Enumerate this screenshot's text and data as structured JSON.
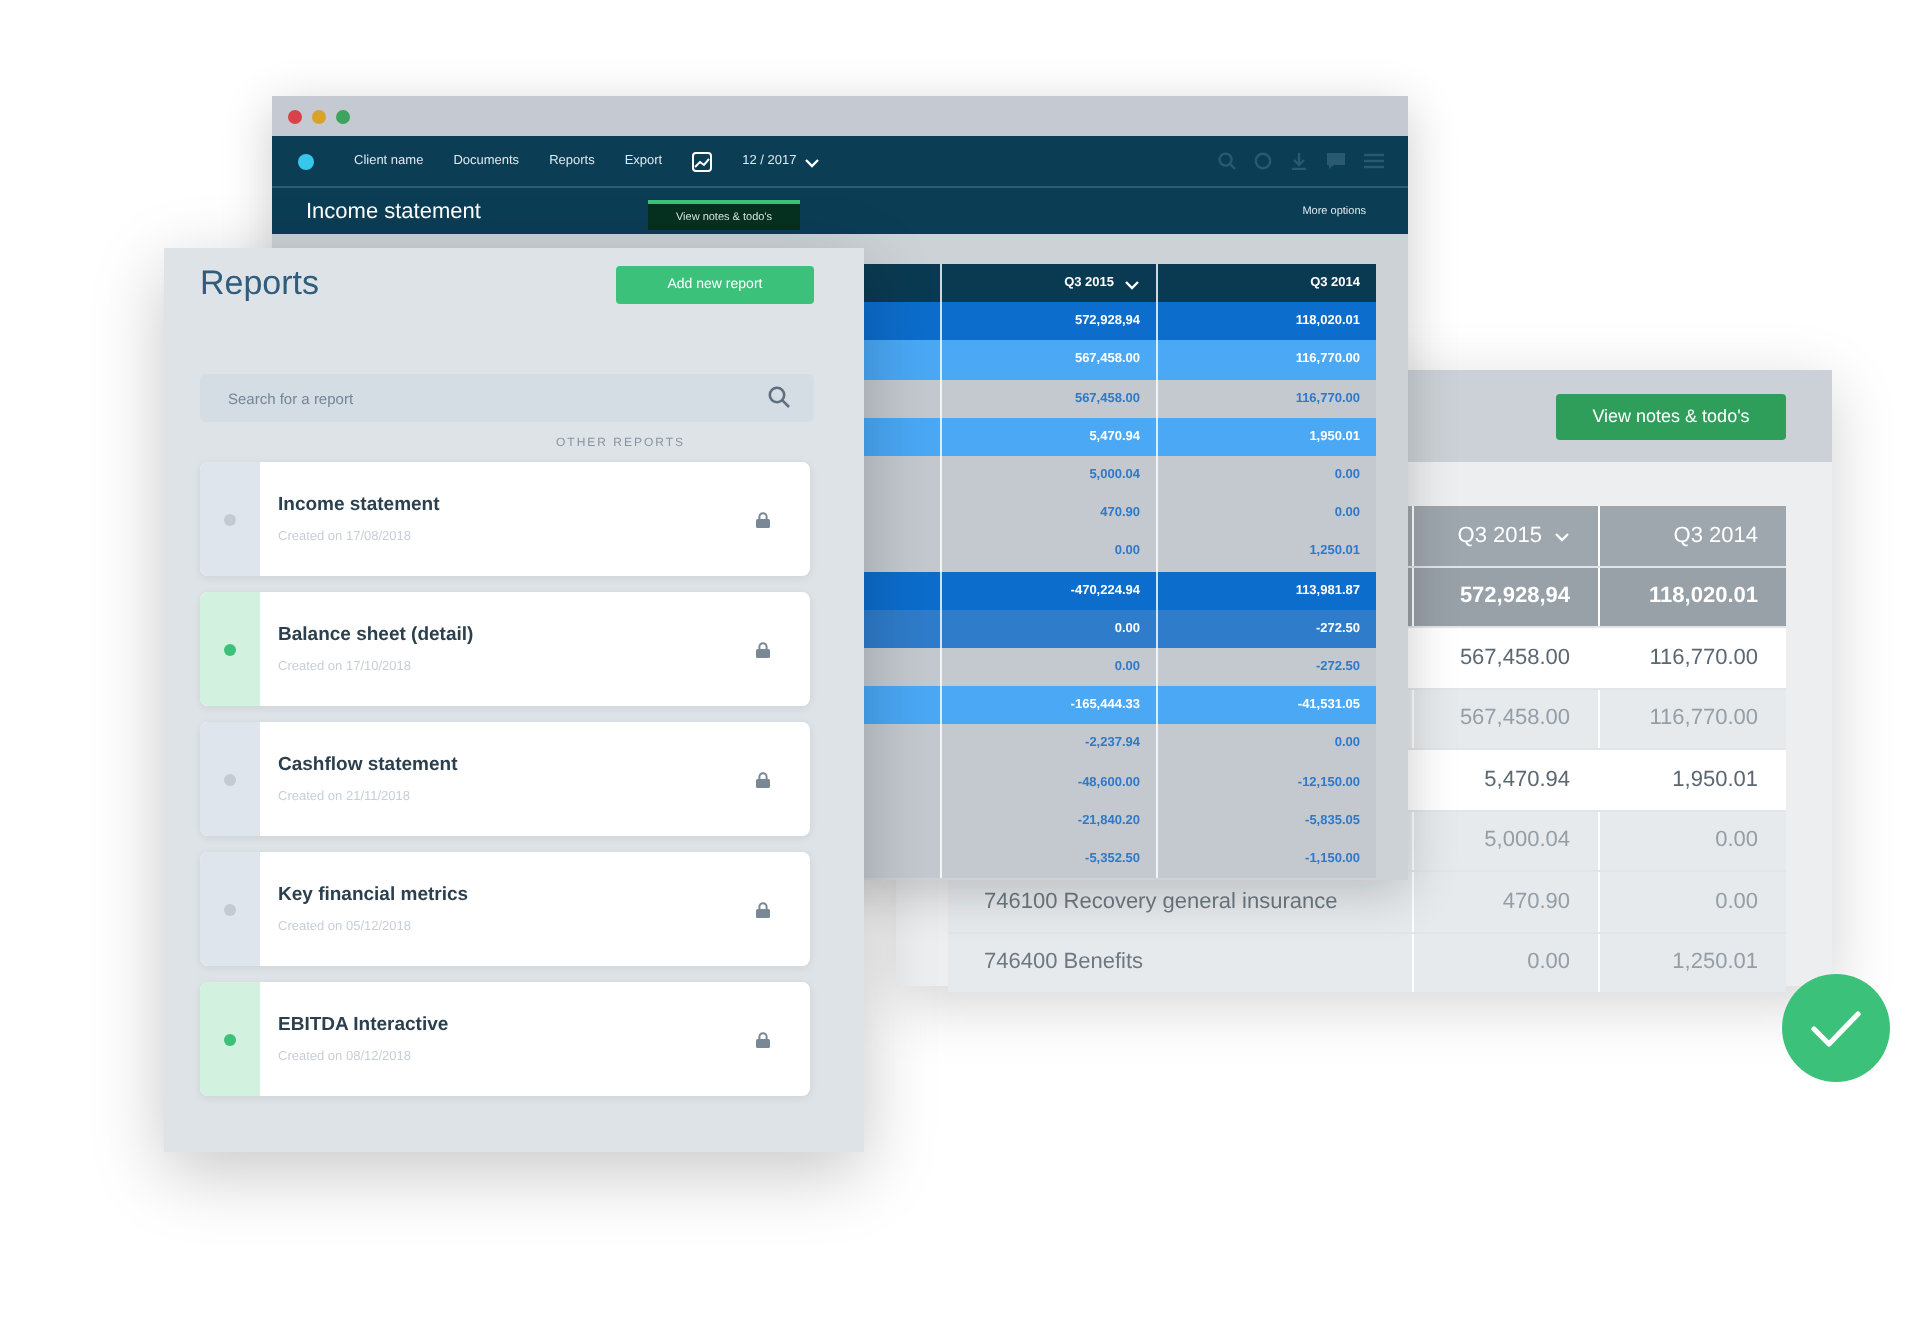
{
  "detail_panel": {
    "notes_button": "View notes & todo's",
    "table": {
      "columns": [
        {
          "label": "Q3 2015",
          "sorted": true
        },
        {
          "label": "Q3 2014",
          "sorted": false
        }
      ],
      "rows": [
        {
          "kind": "group",
          "values": [
            "572,928,94",
            "118,020.01"
          ]
        },
        {
          "kind": "highlight",
          "values": [
            "567,458.00",
            "116,770.00"
          ]
        },
        {
          "kind": "faded",
          "values": [
            "567,458.00",
            "116,770.00"
          ]
        },
        {
          "kind": "highlight",
          "values": [
            "5,470.94",
            "1,950.01"
          ]
        },
        {
          "kind": "faded",
          "values": [
            "5,000.04",
            "0.00"
          ]
        },
        {
          "kind": "faded",
          "label": "746100 Recovery general insurance",
          "values": [
            "470.90",
            "0.00"
          ]
        },
        {
          "kind": "faded",
          "label": "746400 Benefits",
          "values": [
            "0.00",
            "1,250.01"
          ]
        }
      ]
    }
  },
  "app_window": {
    "nav": {
      "items": [
        "Client name",
        "Documents",
        "Reports",
        "Export"
      ],
      "period": "12 / 2017"
    },
    "title": "Income statement",
    "notes_button": "View notes & todo's",
    "more_options": "More options",
    "table": {
      "columns": [
        {
          "label": "Q3 2015",
          "sorted": true
        },
        {
          "label": "Q3 2014",
          "sorted": false
        }
      ],
      "rows": [
        {
          "kind": "group",
          "values": [
            "572,928,94",
            "118,020.01"
          ]
        },
        {
          "kind": "sub",
          "values": [
            "567,458.00",
            "116,770.00"
          ]
        },
        {
          "kind": "plain",
          "values": [
            "567,458.00",
            "116,770.00"
          ]
        },
        {
          "kind": "sub",
          "values": [
            "5,470.94",
            "1,950.01"
          ]
        },
        {
          "kind": "plain",
          "values": [
            "5,000.04",
            "0.00"
          ]
        },
        {
          "kind": "plain",
          "values": [
            "470.90",
            "0.00"
          ]
        },
        {
          "kind": "plain",
          "values": [
            "0.00",
            "1,250.01"
          ]
        },
        {
          "kind": "group",
          "values": [
            "-470,224.94",
            "113,981.87"
          ]
        },
        {
          "kind": "mid",
          "values": [
            "0.00",
            "-272.50"
          ]
        },
        {
          "kind": "plain",
          "values": [
            "0.00",
            "-272.50"
          ]
        },
        {
          "kind": "sub",
          "values": [
            "-165,444.33",
            "-41,531.05"
          ]
        },
        {
          "kind": "plain",
          "values": [
            "-2,237.94",
            "0.00"
          ]
        },
        {
          "kind": "plain",
          "values": [
            "-48,600.00",
            "-12,150.00"
          ]
        },
        {
          "kind": "plain",
          "values": [
            "-21,840.20",
            "-5,835.05"
          ]
        },
        {
          "kind": "plain",
          "values": [
            "-5,352.50",
            "-1,150.00"
          ]
        }
      ]
    }
  },
  "reports_panel": {
    "title": "Reports",
    "add_button": "Add new report",
    "search": {
      "placeholder": "Search for a report"
    },
    "section_label": "OTHER REPORTS",
    "reports": [
      {
        "title": "Income statement",
        "created": "Created on 17/08/2018",
        "active": false
      },
      {
        "title": "Balance sheet (detail)",
        "created": "Created on 17/10/2018",
        "active": true
      },
      {
        "title": "Cashflow statement",
        "created": "Created on 21/11/2018",
        "active": false
      },
      {
        "title": "Key financial metrics",
        "created": "Created on 05/12/2018",
        "active": false
      },
      {
        "title": "EBITDA Interactive",
        "created": "Created on 08/12/2018",
        "active": true
      }
    ]
  }
}
